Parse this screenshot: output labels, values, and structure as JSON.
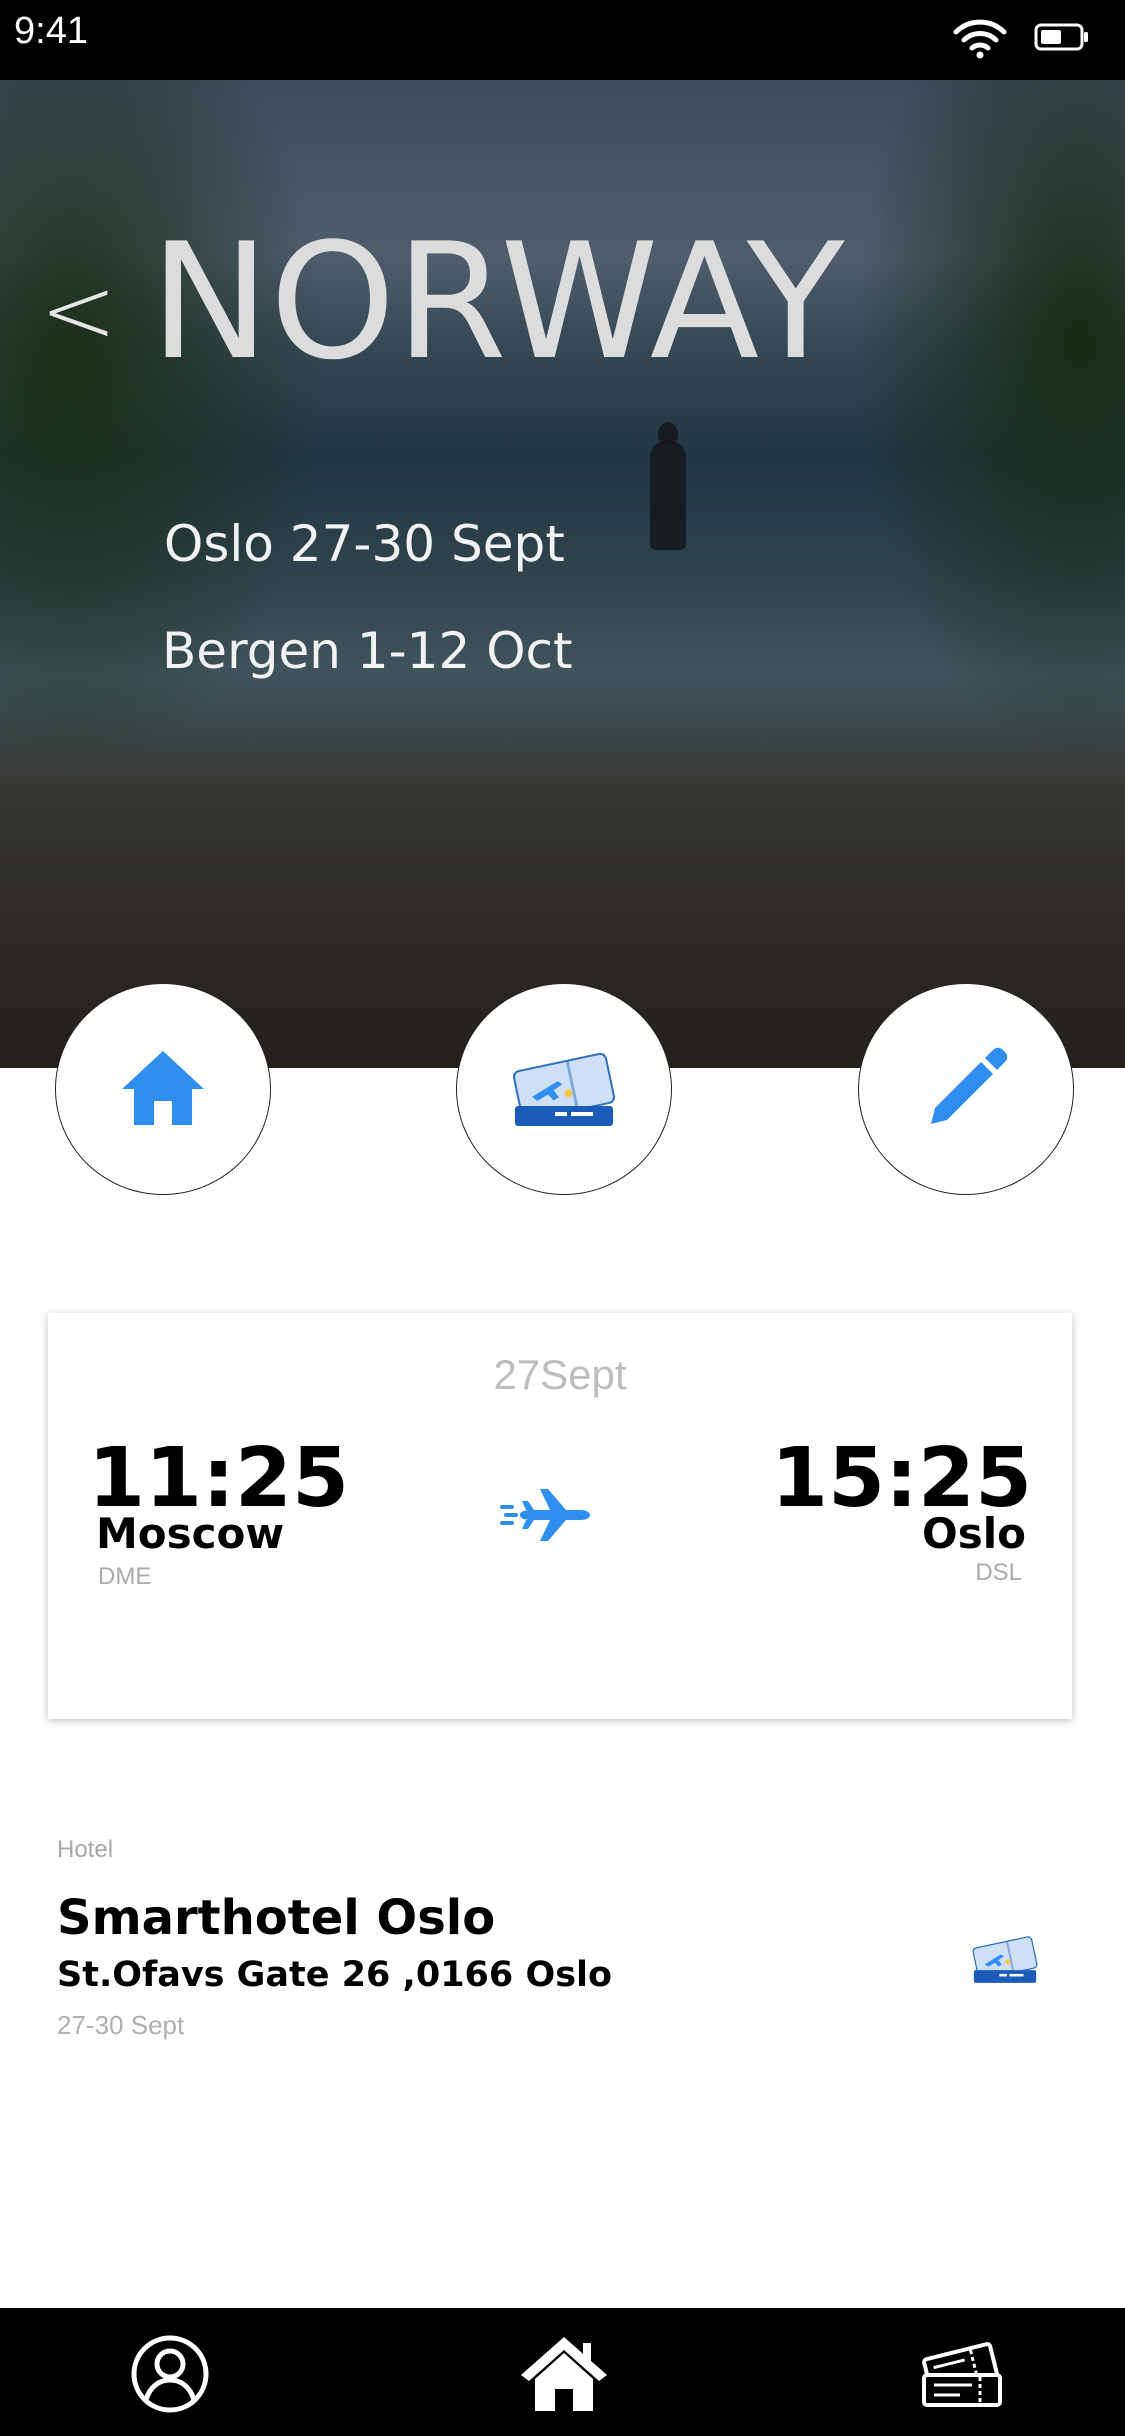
{
  "status_bar": {
    "time": "9:41"
  },
  "hero": {
    "back_label": "<",
    "title": "NORWAY",
    "lines": [
      "Oslo 27-30 Sept",
      "Bergen 1-12 Oct"
    ]
  },
  "actions": [
    {
      "name": "home",
      "icon": "home-icon"
    },
    {
      "name": "tickets",
      "icon": "ticket-icon"
    },
    {
      "name": "edit",
      "icon": "pencil-icon"
    }
  ],
  "flight": {
    "date": "27Sept",
    "departure": {
      "time": "11:25",
      "city": "Moscow",
      "code": "DME"
    },
    "arrival": {
      "time": "15:25",
      "city": "Oslo",
      "code": "DSL"
    },
    "icon": "airplane-icon"
  },
  "hotel": {
    "label": "Hotel",
    "name": "Smarthotel Oslo",
    "address": "St.Ofavs Gate 26 ,0166 Oslo",
    "dates": "27-30 Sept",
    "icon": "ticket-icon"
  },
  "tab_bar": [
    {
      "name": "profile",
      "icon": "user-icon"
    },
    {
      "name": "home",
      "icon": "home-icon"
    },
    {
      "name": "tickets",
      "icon": "ticket-icon"
    }
  ],
  "colors": {
    "accent": "#2f8ff0",
    "status_bar": "#000000",
    "tab_bar": "#000000"
  }
}
